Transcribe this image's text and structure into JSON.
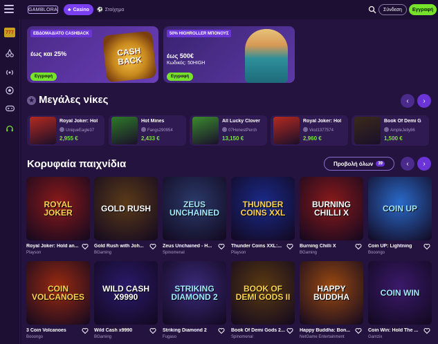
{
  "header": {
    "logo": "GAMBLORA",
    "tab_casino": "Casino",
    "tab_bet": "Στοίχημα",
    "login": "Σύνδεση",
    "register": "Εγγραφή"
  },
  "promos": [
    {
      "title": "ΕΒΔΟΜΑΔΙΑΤΟ CASHBACK",
      "line1": "έως και 25%",
      "line2": "",
      "button": "Εγγραφή"
    },
    {
      "title": "50% HIGHROLLER ΜΠΟΝΟΥΣ",
      "line1": "έως 500€",
      "line2": "Κωδικός: 50HIGH",
      "button": "Εγγραφή"
    }
  ],
  "big_wins": {
    "title": "Μεγάλες νίκες",
    "items": [
      {
        "name": "Royal Joker: Hol",
        "user": "UniqueEagle37",
        "amount": "2,955 €",
        "color": "#b5291f"
      },
      {
        "name": "Hot Mines",
        "user": "Fangs290954",
        "amount": "2,433 €",
        "color": "#2e7a27"
      },
      {
        "name": "All Lucky Clover",
        "user": "07HonestPerch",
        "amount": "13,150 €",
        "color": "#3a8a2e"
      },
      {
        "name": "Royal Joker: Hol",
        "user": "Vicd1377574",
        "amount": "2,960 €",
        "color": "#b5291f"
      },
      {
        "name": "Book Of Demi G",
        "user": "AmpleJelly86",
        "amount": "1,500 €",
        "color": "#3a2a1a"
      }
    ]
  },
  "top_games": {
    "title": "Κορυφαία παιχνίδια",
    "view_all": "Προβολή όλων",
    "count": "39",
    "items": [
      {
        "name": "Royal Joker: Hold an...",
        "provider": "Playson",
        "art": "ROYAL JOKER",
        "bg": "#8a1a1a"
      },
      {
        "name": "Gold Rush with Joh...",
        "provider": "BGaming",
        "art": "GOLD RUSH",
        "bg": "#5a3a18"
      },
      {
        "name": "Zeus Unchained - H...",
        "provider": "Spinomenal",
        "art": "ZEUS UNCHAINED",
        "bg": "#2a3a6a"
      },
      {
        "name": "Thunder Coins XXL:...",
        "provider": "Playson",
        "art": "THUNDER COINS XXL",
        "bg": "#1a2a8a"
      },
      {
        "name": "Burning Chilli X",
        "provider": "BGaming",
        "art": "BURNING CHILLI X",
        "bg": "#8a1a1a"
      },
      {
        "name": "Coin UP: Lightning",
        "provider": "Booongo",
        "art": "COIN UP",
        "bg": "#2a6aca"
      },
      {
        "name": "3 Coin Volcanoes",
        "provider": "Booongo",
        "art": "COIN VOLCANOES",
        "bg": "#9a2a10"
      },
      {
        "name": "Wild Cash x9990",
        "provider": "BGaming",
        "art": "WILD CASH X9990",
        "bg": "#2a1a6a"
      },
      {
        "name": "Striking Diamond 2",
        "provider": "Fugaso",
        "art": "STRIKING DIAMOND 2",
        "bg": "#3a2a7a"
      },
      {
        "name": "Book Of Demi Gods 2...",
        "provider": "Spinomenal",
        "art": "BOOK OF DEMI GODS II",
        "bg": "#5a3a10"
      },
      {
        "name": "Happy Buddha: Bon...",
        "provider": "NetGame Entertainment",
        "art": "HAPPY BUDDHA",
        "bg": "#9a4a10"
      },
      {
        "name": "Coin Win: Hold The ...",
        "provider": "Gamzix",
        "art": "COIN WIN",
        "bg": "#3a1a6a"
      }
    ]
  }
}
